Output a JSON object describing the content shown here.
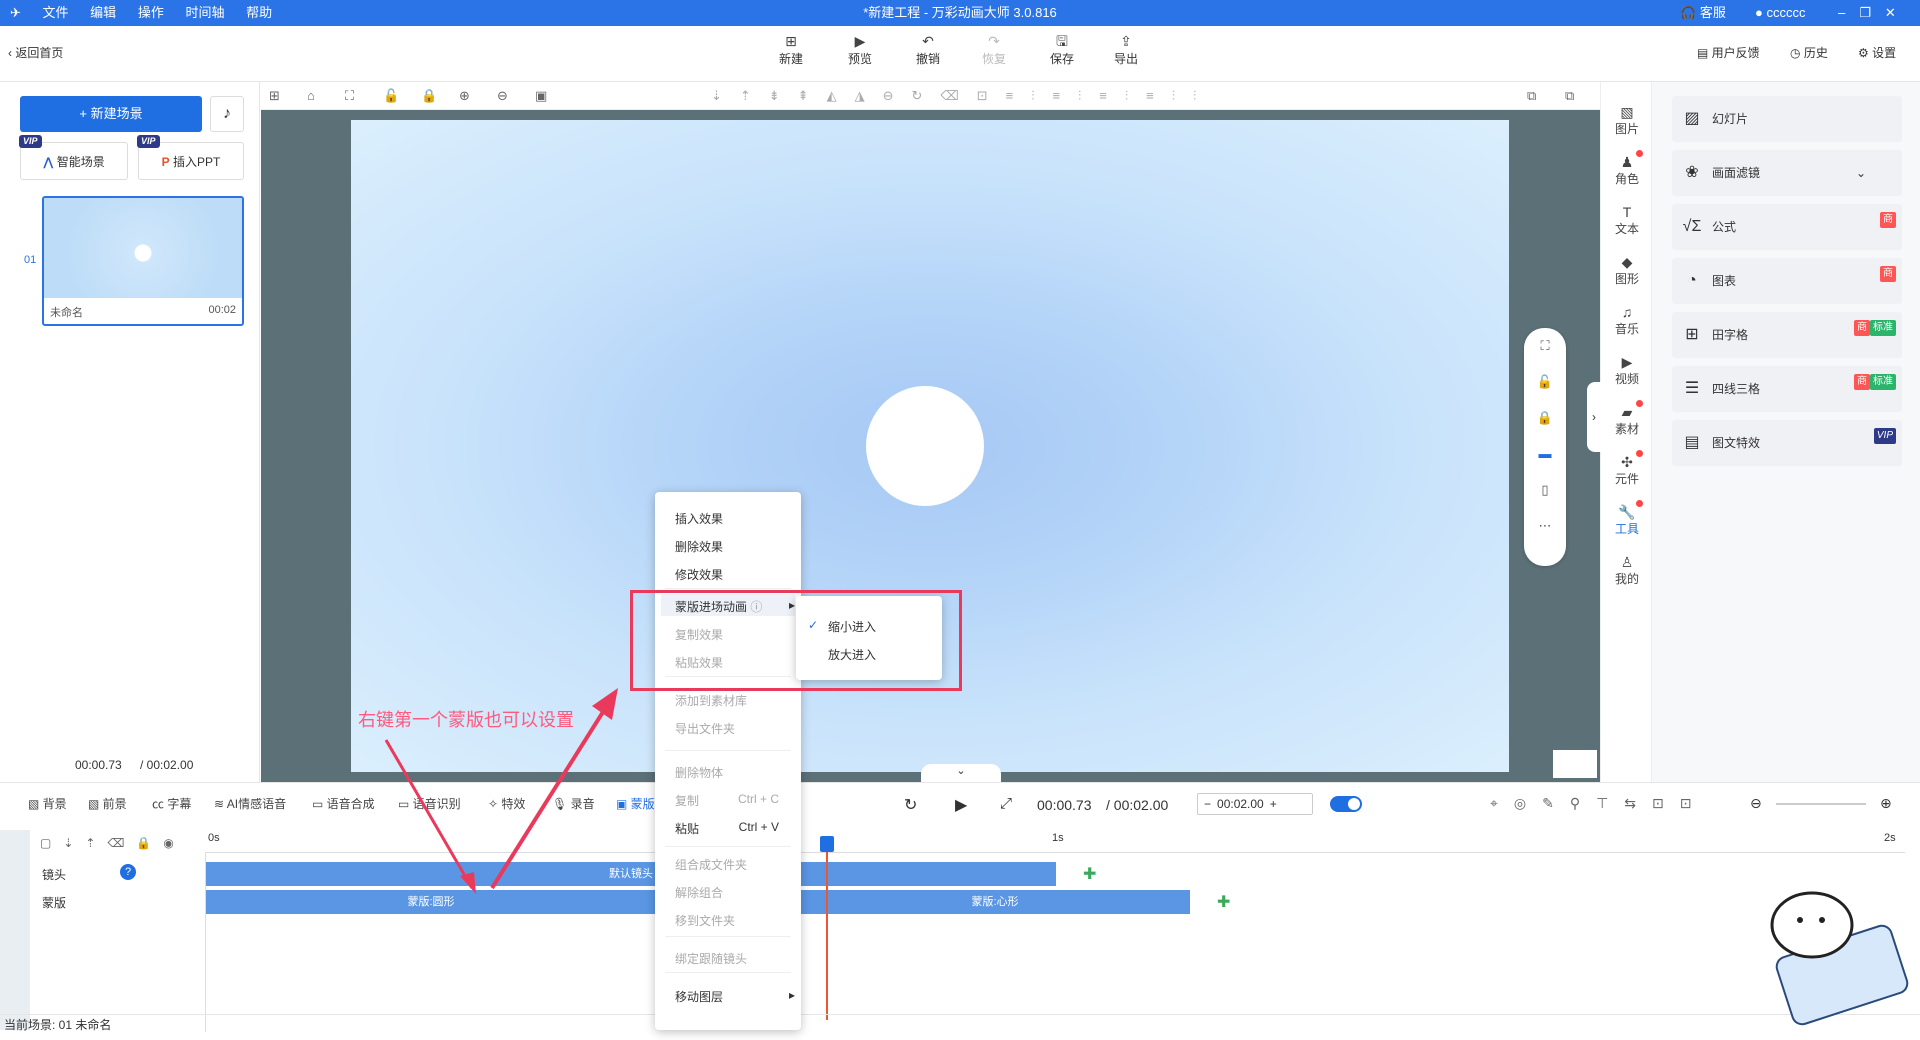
{
  "titlebar": {
    "menus": [
      "文件",
      "编辑",
      "操作",
      "时间轴",
      "帮助"
    ],
    "title": "*新建工程 - 万彩动画大师 3.0.816",
    "service": "客服",
    "user": "cccccc"
  },
  "toolbar": {
    "back": "返回首页",
    "new": "新建",
    "preview": "预览",
    "undo": "撤销",
    "redo": "恢复",
    "save": "保存",
    "export": "导出",
    "feedback": "用户反馈",
    "history": "历史",
    "settings": "设置"
  },
  "left": {
    "new_scene": "+ 新建场景",
    "smart_scene": "智能场景",
    "insert_ppt": "插入PPT",
    "vip": "VIP",
    "scene_index": "01",
    "scene_name": "未命名",
    "scene_duration": "00:02",
    "time_current": "00:00.73",
    "time_total": "/ 00:02.00"
  },
  "rightnav": [
    "图片",
    "角色",
    "文本",
    "图形",
    "音乐",
    "视频",
    "素材",
    "元件",
    "工具",
    "我的"
  ],
  "rightpanel": {
    "items": [
      "幻灯片",
      "画面滤镜",
      "公式",
      "图表",
      "田字格",
      "四线三格",
      "图文特效"
    ],
    "tag_shang": "商",
    "tag_std": "标准",
    "tag_vip": "VIP"
  },
  "timeline": {
    "tabs": [
      "背景",
      "前景",
      "字幕",
      "AI情感语音",
      "语音合成",
      "语音识别",
      "特效",
      "录音",
      "蒙版"
    ],
    "time_current": "00:00.73",
    "time_total": "/ 00:02.00",
    "step_value": "00:02.00",
    "ruler": [
      "0s",
      "1s",
      "2s"
    ],
    "tracks": [
      "镜头",
      "蒙版"
    ],
    "clips": {
      "camera": "默认镜头",
      "mask1": "蒙版:圆形",
      "mask2": "蒙版:心形"
    },
    "status": "当前场景: 01   未命名"
  },
  "context_menu": {
    "items": [
      "插入效果",
      "删除效果",
      "修改效果",
      "蒙版进场动画",
      "复制效果",
      "粘贴效果",
      "添加到素材库",
      "导出文件夹",
      "删除物体",
      "复制",
      "粘贴",
      "组合成文件夹",
      "解除组合",
      "移到文件夹",
      "绑定跟随镜头",
      "移动图层"
    ],
    "shortcut_copy": "Ctrl + C",
    "shortcut_paste": "Ctrl + V"
  },
  "submenu": {
    "items": [
      "缩小进入",
      "放大进入"
    ]
  },
  "annotation": "右键第一个蒙版也可以设置",
  "colors": {
    "accent": "#2b74e8",
    "annotation": "#ea3a5c"
  }
}
